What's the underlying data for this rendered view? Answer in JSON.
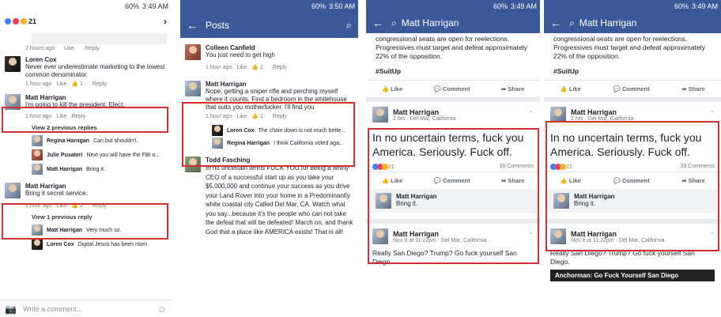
{
  "panel1": {
    "status_time": "3:49 AM",
    "status_batt": "60%",
    "react_count": "21",
    "top_meta": [
      "2 hours ago",
      "Like",
      "Reply"
    ],
    "comments": [
      {
        "name": "Loren Cox",
        "text": "Never ever underestimate marketing to the lowest common denominator.",
        "time": "1 hour ago",
        "like": "Like",
        "count": "1",
        "reply": "Reply"
      },
      {
        "name": "Matt Harrigan",
        "text": "I'm going to kill the president. Elect.",
        "time": "1 hour ago",
        "like": "Like",
        "reply": "Reply"
      }
    ],
    "view2": "View 2 previous replies",
    "replies1": [
      {
        "name": "Regina Harrigan",
        "text": "Can but shouldn't."
      },
      {
        "name": "Julie Pusateri",
        "text": "Next you will have the FBI o..."
      },
      {
        "name": "Matt Harrigan",
        "text": "Bring it."
      }
    ],
    "c3": {
      "name": "Matt Harrigan",
      "text": "Bring it secret service.",
      "time": "1 hour ago",
      "like": "Like",
      "count": "2",
      "reply": "Reply"
    },
    "view1": "View 1 previous reply",
    "replies2": [
      {
        "name": "Matt Harrigan",
        "text": "Very much so."
      },
      {
        "name": "Loren Cox",
        "text": "Digital Jesus has been risen"
      }
    ],
    "write_placeholder": "Write a comment..."
  },
  "panel2": {
    "status_time": "3:50 AM",
    "status_batt": "60%",
    "title": "Posts",
    "c1": {
      "name": "Colleen Canfield",
      "text": "You just need to get high",
      "time": "1 hour ago",
      "like": "Like",
      "count": "1",
      "reply": "Reply"
    },
    "c2": {
      "name": "Matt Harrigan",
      "text": "Nope, getting a sniper rifle and perching myself where it counts. Find a bedroom in the whitehouse that suits you motherfucker. I'll find you",
      "time": "1 hour ago",
      "like": "Like",
      "count": "1",
      "reply": "Reply"
    },
    "replies": [
      {
        "name": "Loren Cox",
        "text": "The chain down is not much bette..."
      },
      {
        "name": "Regina Harrigan",
        "text": "I think California voted aga..."
      }
    ],
    "c3": {
      "name": "Todd Fasching",
      "text": "In no uncertain terms FUCK YOU for being a whiny CEO of a successful start up as you take your $5,000,000 and continue your success as you drive your Land Rover into your home in a Predominantly white coastal city Called Del Mar, CA. Watch what you say...because it's the people who can not take the defeat that will be defeated! March on, and thank God that a place like AMERICA exists! That is all!"
    }
  },
  "panel3": {
    "status_time": "3:49 AM",
    "status_batt": "60%",
    "search_text": "Matt Harrigan",
    "prev_text": "congressional seats are open for reelections. Progressives must target and defeat approximately 22% of the opposition.",
    "hashtag": "#SuitUp",
    "actions": [
      "Like",
      "Comment",
      "Share"
    ],
    "post": {
      "name": "Matt Harrigan",
      "sub": "2 hrs · Del Mar, California ·",
      "text": "In no uncertain terms, fuck you America. Seriously. Fuck off.",
      "reacts": "21",
      "comments": "39 Comments"
    },
    "reply": {
      "name": "Matt Harrigan",
      "text": "Bring it."
    },
    "post2": {
      "name": "Matt Harrigan",
      "sub": "Nov 8 at 11:22pm · Del Mar, California ·",
      "text": "Really San Diego? Trump? Go fuck yourself San Diego."
    }
  },
  "panel4": {
    "status_time": "3:49 AM",
    "status_batt": "60%",
    "search_text": "Matt Harrigan",
    "prev_text": "congressional seats are open for reelections. Progressives must target and defeat approximately 22% of the opposition.",
    "hashtag": "#SuitUp",
    "actions": [
      "Like",
      "Comment",
      "Share"
    ],
    "post": {
      "name": "Matt Harrigan",
      "sub": "2 hrs · Del Mar, California ·",
      "text": "In no uncertain terms, fuck you America. Seriously. Fuck off.",
      "reacts": "21",
      "comments": "39 Comments"
    },
    "reply": {
      "name": "Matt Harrigan",
      "text": "Bring it."
    },
    "post2": {
      "name": "Matt Harrigan",
      "sub": "Nov 8 at 11:22pm · Del Mar, California ·",
      "text": "Really San Diego? Trump? Go fuck yourself San Diego.",
      "link": "Anchorman: Go Fuck Yourself San Diego"
    }
  },
  "colors": {
    "fb_blue": "#3b5998",
    "highlight": "#d32f2f"
  }
}
